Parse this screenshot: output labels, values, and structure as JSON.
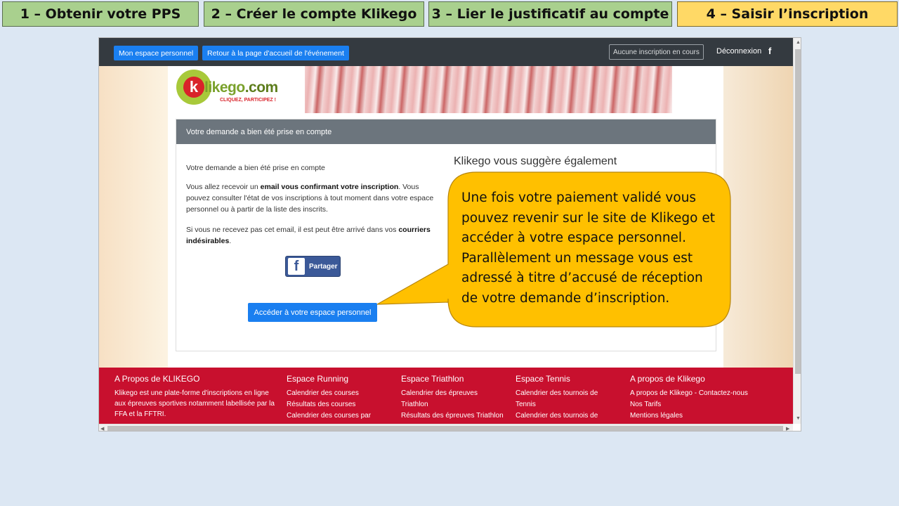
{
  "steps": [
    {
      "label": "1 – Obtenir votre PPS",
      "state": "done"
    },
    {
      "label": "2 – Créer le compte Klikego",
      "state": "done"
    },
    {
      "label": "3 – Lier le justificatif au compte",
      "state": "done"
    },
    {
      "label": "4 – Saisir l’inscription",
      "state": "active"
    }
  ],
  "nav": {
    "personal_space": "Mon espace personnel",
    "back_event": "Retour à la page d'accueil de l'événement",
    "no_registration": "Aucune inscription en cours",
    "logout": "Déconnexion",
    "facebook_icon": "f"
  },
  "logo": {
    "k": "k",
    "brand_a": "likego",
    "brand_b": ".com",
    "slogan": "CLIQUEZ, PARTICIPEZ !"
  },
  "card": {
    "header": "Votre demande a bien été prise en compte",
    "line1": "Votre demande a bien été prise en compte",
    "p2_a": "Vous allez recevoir un ",
    "p2_b": "email vous confirmant votre inscription",
    "p2_c": ". Vous pouvez consulter l'état de vos inscriptions à tout moment dans votre espace personnel ou à partir de la liste des inscrits.",
    "p3_a": "Si vous ne recevez pas cet email, il est peut être arrivé dans vos ",
    "p3_b": "courriers indésirables",
    "p3_c": ".",
    "share_label": "Partager",
    "access_button": "Accéder à votre espace personnel",
    "suggest_title": "Klikego vous suggère également"
  },
  "footer": {
    "about": {
      "title": "A Propos de KLIKEGO",
      "text": "Klikego est une plate-forme d'inscriptions en ligne aux épreuves sportives notamment labellisée par la FFA et la FFTRI."
    },
    "running": {
      "title": "Espace Running",
      "links": [
        "Calendrier des courses",
        "Résultats des courses",
        "Calendrier des courses par"
      ]
    },
    "triathlon": {
      "title": "Espace Triathlon",
      "links": [
        "Calendrier des épreuves Triathlon",
        "Résultats des épreuves Triathlon"
      ]
    },
    "tennis": {
      "title": "Espace Tennis",
      "links": [
        "Calendrier des tournois de Tennis",
        "Calendrier des tournois de"
      ]
    },
    "klikego": {
      "title": "A propos de Klikego",
      "links": [
        "A propos de Klikego - Contactez-nous",
        "Nos Tarifs",
        "Mentions légales"
      ]
    }
  },
  "callout": {
    "text": "Une fois votre paiement validé vous pouvez revenir sur le site de Klikego et accéder à votre espace personnel. Parallèlement un message vous est adressé à titre d’accusé de réception de votre demande d’inscription."
  },
  "colors": {
    "step_done": "#a9d08e",
    "step_active": "#ffd966",
    "callout_fill": "#ffc000",
    "footer": "#c8102e",
    "primary_button": "#1a7ff0"
  }
}
